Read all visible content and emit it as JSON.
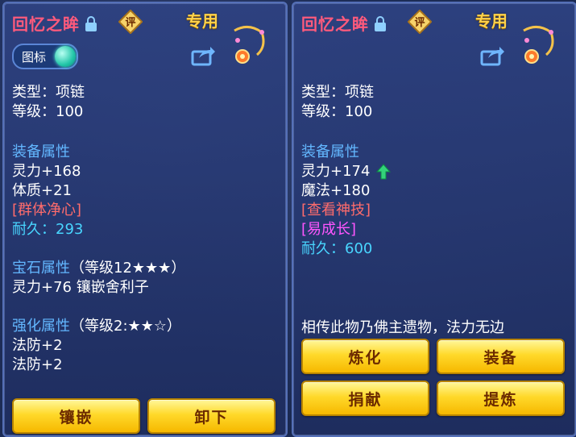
{
  "left": {
    "item_name": "回忆之眸",
    "rate_glyph": "评",
    "exclusive": "专用",
    "toggle_label": "图标",
    "type_line": "类型：项链",
    "level_line": "等级：100",
    "equip_attr_title": "装备属性",
    "stat1": "灵力+168",
    "stat2": "体质+21",
    "skill": "[群体净心]",
    "durability_label": "耐久：",
    "durability_value": "293",
    "gem_title": "宝石属性",
    "gem_level": "（等级12★★★）",
    "gem_effect": "灵力+76 镶嵌舍利子",
    "enhance_title": "强化属性",
    "enhance_level": "（等级2:★★☆）",
    "enhance1": "法防+2",
    "enhance2": "法防+2",
    "btn_inlay": "镶嵌",
    "btn_unload": "卸下"
  },
  "right": {
    "item_name": "回忆之眸",
    "rate_glyph": "评",
    "exclusive": "专用",
    "type_line": "类型：项链",
    "level_line": "等级：100",
    "equip_attr_title": "装备属性",
    "stat1": "灵力+174",
    "stat2": "魔法+180",
    "skill": "[查看神技]",
    "special": "[易成长]",
    "durability_label": "耐久：",
    "durability_value": "600",
    "description": "相传此物乃佛主遗物，法力无边",
    "btn_refine": "炼化",
    "btn_equip": "装备",
    "btn_donate": "捐献",
    "btn_extract": "提炼"
  },
  "colors": {
    "name": "#ff5a7c",
    "section": "#63b7ff",
    "cyan": "#49d6ff",
    "red_skill": "#ff6c6c",
    "pink_skill": "#ff56ff",
    "gold_button": "#ffd92a"
  }
}
